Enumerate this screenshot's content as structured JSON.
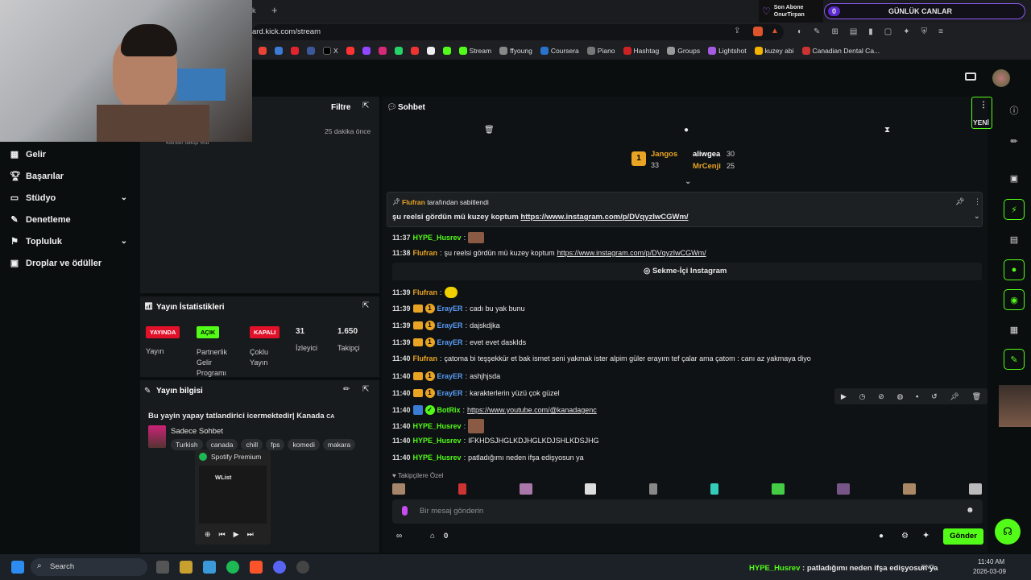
{
  "browser": {
    "tab_partial": "k",
    "url": "ard.kick.com/stream",
    "bookmarks": [
      "X",
      "Stream",
      "ffyoung",
      "Coursera",
      "Piano",
      "Hashtag",
      "Groups",
      "Lightshot",
      "kuzey abi",
      "Canadian Dental Ca..."
    ],
    "sub_box": {
      "title": "Son Abone",
      "name": "OnurTirpan"
    },
    "hearts_box": {
      "count": "0",
      "label": "GÜNLÜK CANLAR"
    }
  },
  "nav": {
    "items": [
      {
        "label": "Gelir",
        "icon": "income-icon"
      },
      {
        "label": "Başarılar",
        "icon": "trophy-icon"
      },
      {
        "label": "Stüdyo",
        "icon": "studio-icon",
        "chevron": true
      },
      {
        "label": "Denetleme",
        "icon": "wrench-icon"
      },
      {
        "label": "Topluluk",
        "icon": "community-icon",
        "chevron": true
      },
      {
        "label": "Droplar ve ödüller",
        "icon": "drops-icon"
      }
    ]
  },
  "activity": {
    "filter_label": "Filtre",
    "time": "25 dakika önce",
    "partial_text": "kanalı takip etti"
  },
  "stats": {
    "title": "Yayın İstatistikleri",
    "items": [
      {
        "badge": "YAYINDA",
        "label": "Yayın",
        "color": "#e2112a"
      },
      {
        "badge": "AÇIK",
        "label": "Partnerlik Gelir Programı",
        "color": "#53fc18"
      },
      {
        "badge": "KAPALI",
        "label": "Çoklu Yayın",
        "color": "#e2112a"
      },
      {
        "value": "31",
        "label": "İzleyici"
      },
      {
        "value": "1.650",
        "label": "Takipçi"
      }
    ]
  },
  "stream_info": {
    "title": "Yayın bilgisi",
    "stream_title": "Bu yayin yapay tatlandirici icermektedir| Kanada",
    "country": "CA",
    "category": "Sadece Sohbet",
    "tags": [
      "Turkish",
      "canada",
      "chill",
      "fps",
      "komedi",
      "makara"
    ]
  },
  "spotify": {
    "label": "Spotify Premium",
    "playlist": "WList"
  },
  "chat": {
    "title": "Sohbet",
    "new_label": "YENİ",
    "leaderboard": {
      "first": {
        "name": "Jangos",
        "count": "33",
        "rank": "1"
      },
      "second": {
        "name": "aliwgea",
        "count": "30"
      },
      "third": {
        "name": "MrCenji",
        "count": "25"
      }
    },
    "pinned": {
      "by_user": "Flufran",
      "by_text": "tarafından sabitlendi",
      "text": "şu reelsi gördün mü kuzey koptum",
      "link": "https://www.instagram.com/p/DVqyzIwCGWm/"
    },
    "messages": [
      {
        "time": "11:37",
        "user": "HYPE_Husrev",
        "color": "#53fc18",
        "text": "",
        "emote": true
      },
      {
        "time": "11:38",
        "user": "Flufran",
        "color": "#e8a422",
        "text": "şu reelsi gördün mü kuzey koptum ",
        "link": "https://www.instagram.com/p/DVqyzIwCGWm/"
      },
      {
        "time": "11:39",
        "user": "Flufran",
        "color": "#e8a422",
        "text": "",
        "emote": true
      },
      {
        "time": "11:39",
        "user": "ErayER",
        "color": "#5a9cf5",
        "text": "cadı bu yak bunu",
        "badges": true
      },
      {
        "time": "11:39",
        "user": "ErayER",
        "color": "#5a9cf5",
        "text": "dajskdjka",
        "badges": true
      },
      {
        "time": "11:39",
        "user": "ErayER",
        "color": "#5a9cf5",
        "text": "evet evet daskIds",
        "badges": true
      },
      {
        "time": "11:40",
        "user": "Flufran",
        "color": "#e8a422",
        "text": "çatoma bi teşşekkür et bak ismet seni yakmak ister alpim güler erayım tef çalar ama çatom : canı az yakmaya diyo"
      },
      {
        "time": "11:40",
        "user": "ErayER",
        "color": "#5a9cf5",
        "text": "ashjhjsda",
        "badges": true
      },
      {
        "time": "11:40",
        "user": "ErayER",
        "color": "#5a9cf5",
        "text": "karakterlerin yüzü çok güzel",
        "badges": true
      },
      {
        "time": "11:40",
        "user": "BotRix",
        "color": "#53fc18",
        "text": "",
        "link": "https://www.youtube.com/@kanadagenc",
        "bot": true
      },
      {
        "time": "11:40",
        "user": "HYPE_Husrev",
        "color": "#53fc18",
        "text": "",
        "emote": true
      },
      {
        "time": "11:40",
        "user": "HYPE_Husrev",
        "color": "#53fc18",
        "text": "IFKHDSJHGLKDJHGLKDJSHLKDSJHG"
      },
      {
        "time": "11:40",
        "user": "HYPE_Husrev",
        "color": "#53fc18",
        "text": "patladığımı neden ifşa edişyosun ya"
      }
    ],
    "instagram_card": "Sekme-İçi Instagram",
    "followers_label": "Takipçilere Özel",
    "input_placeholder": "Bir mesaj gönderin",
    "send_label": "Gönder",
    "points": "0"
  },
  "taskbar": {
    "search": "Search",
    "ticker_user": "HYPE_Husrev",
    "ticker_text": " : patladığımı neden ifşa edişyosun ya",
    "lang": "ENG",
    "time": "11:40 AM",
    "date": "2026-03-09"
  }
}
